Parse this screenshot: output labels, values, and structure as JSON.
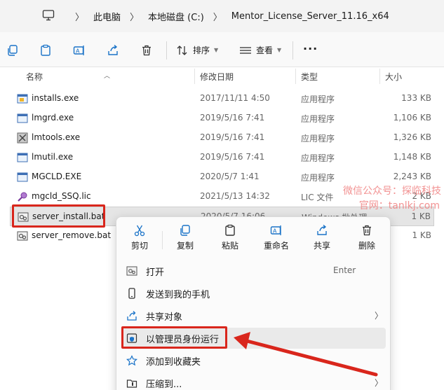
{
  "breadcrumb": {
    "items": [
      "此电脑",
      "本地磁盘 (C:)",
      "Mentor_License_Server_11.16_x64"
    ]
  },
  "toolbar": {
    "sort_label": "排序",
    "view_label": "查看",
    "more_label": "···"
  },
  "columns": {
    "name": "名称",
    "date": "修改日期",
    "type": "类型",
    "size": "大小"
  },
  "files": [
    {
      "name": "installs.exe",
      "date": "2017/11/11 4:50",
      "type": "应用程序",
      "size": "133 KB",
      "icon": "exe-icon"
    },
    {
      "name": "lmgrd.exe",
      "date": "2019/5/16 7:41",
      "type": "应用程序",
      "size": "1,106 KB",
      "icon": "exe-icon"
    },
    {
      "name": "lmtools.exe",
      "date": "2019/5/16 7:41",
      "type": "应用程序",
      "size": "1,326 KB",
      "icon": "tools-exe-icon"
    },
    {
      "name": "lmutil.exe",
      "date": "2019/5/16 7:41",
      "type": "应用程序",
      "size": "1,148 KB",
      "icon": "exe-icon"
    },
    {
      "name": "MGCLD.EXE",
      "date": "2020/5/7 1:41",
      "type": "应用程序",
      "size": "2,243 KB",
      "icon": "exe-icon"
    },
    {
      "name": "mgcld_SSQ.lic",
      "date": "2021/5/13 14:32",
      "type": "LIC 文件",
      "size": "2 KB",
      "icon": "lic-icon"
    },
    {
      "name": "server_install.bat",
      "date": "2020/5/7 16:06",
      "type": "Windows 批处理",
      "size": "1 KB",
      "icon": "bat-icon"
    },
    {
      "name": "server_remove.bat",
      "date": "",
      "type": "",
      "size": "1 KB",
      "icon": "bat-icon"
    }
  ],
  "watermark": {
    "line1": "微信公众号：探临科技",
    "line2": "官网：tanlkj.com"
  },
  "context_menu": {
    "quick_actions": [
      {
        "label": "剪切",
        "icon": "scissors-icon"
      },
      {
        "label": "复制",
        "icon": "copy-icon"
      },
      {
        "label": "粘贴",
        "icon": "paste-icon"
      },
      {
        "label": "重命名",
        "icon": "rename-icon"
      },
      {
        "label": "共享",
        "icon": "share-icon"
      },
      {
        "label": "删除",
        "icon": "trash-icon"
      }
    ],
    "items": [
      {
        "label": "打开",
        "shortcut": "Enter",
        "icon": "open-icon"
      },
      {
        "label": "发送到我的手机",
        "icon": "phone-icon"
      },
      {
        "label": "共享对象",
        "icon": "share-icon",
        "submenu": true
      },
      {
        "label": "以管理员身份运行",
        "icon": "shield-icon"
      },
      {
        "label": "添加到收藏夹",
        "icon": "star-icon"
      },
      {
        "label": "压缩到...",
        "icon": "archive-icon",
        "submenu": true
      }
    ]
  },
  "colors": {
    "highlight_red": "#d9261c",
    "accent_blue": "#1a73c8"
  }
}
